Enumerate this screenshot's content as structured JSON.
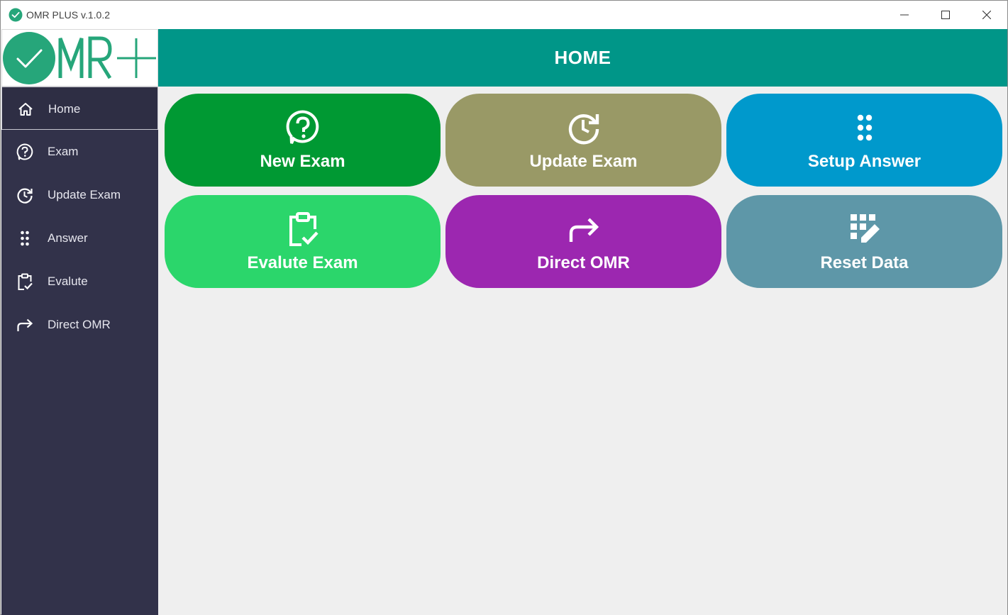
{
  "window": {
    "title": "OMR PLUS v.1.0.2"
  },
  "header": {
    "title": "HOME"
  },
  "sidebar": {
    "items": [
      {
        "label": "Home",
        "icon": "home-icon"
      },
      {
        "label": "Exam",
        "icon": "question-icon"
      },
      {
        "label": "Update Exam",
        "icon": "update-icon"
      },
      {
        "label": "Answer",
        "icon": "dots-grid-icon"
      },
      {
        "label": "Evalute",
        "icon": "clipboard-check-icon"
      },
      {
        "label": "Direct OMR",
        "icon": "share-arrow-icon"
      }
    ]
  },
  "tiles": [
    {
      "label": "New Exam",
      "color": "#009933",
      "icon": "question-icon"
    },
    {
      "label": "Update Exam",
      "color": "#999966",
      "icon": "update-icon"
    },
    {
      "label": "Setup Answer",
      "color": "#0099cc",
      "icon": "dots-grid-icon"
    },
    {
      "label": "Evalute Exam",
      "color": "#2bd66b",
      "icon": "clipboard-check-icon"
    },
    {
      "label": "Direct OMR",
      "color": "#9c27b0",
      "icon": "share-arrow-icon"
    },
    {
      "label": "Reset Data",
      "color": "#5e97a8",
      "icon": "grid-edit-icon"
    }
  ],
  "colors": {
    "header": "#009688",
    "sidebar": "#32324a",
    "content_bg": "#efefef",
    "logo_green": "#26a67a"
  }
}
